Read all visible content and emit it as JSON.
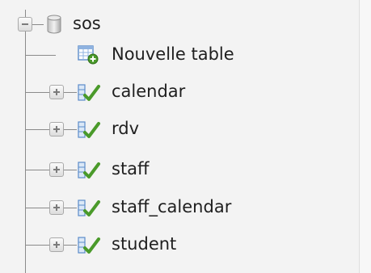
{
  "tree": {
    "database": {
      "name": "sos",
      "icon": "database-icon",
      "expanded": true
    },
    "new_table": {
      "label": "Nouvelle table",
      "icon": "new-table-icon"
    },
    "tables": [
      {
        "label": "calendar",
        "icon": "table-icon"
      },
      {
        "label": "rdv",
        "icon": "table-icon"
      },
      {
        "label": "staff",
        "icon": "table-icon"
      },
      {
        "label": "staff_calendar",
        "icon": "table-icon"
      },
      {
        "label": "student",
        "icon": "table-icon"
      }
    ]
  },
  "colors": {
    "background": "#f3f3f3",
    "tree_line": "#8a8a8a",
    "table_icon_green": "#4a9a2a",
    "table_icon_blue": "#5b8cc9"
  }
}
